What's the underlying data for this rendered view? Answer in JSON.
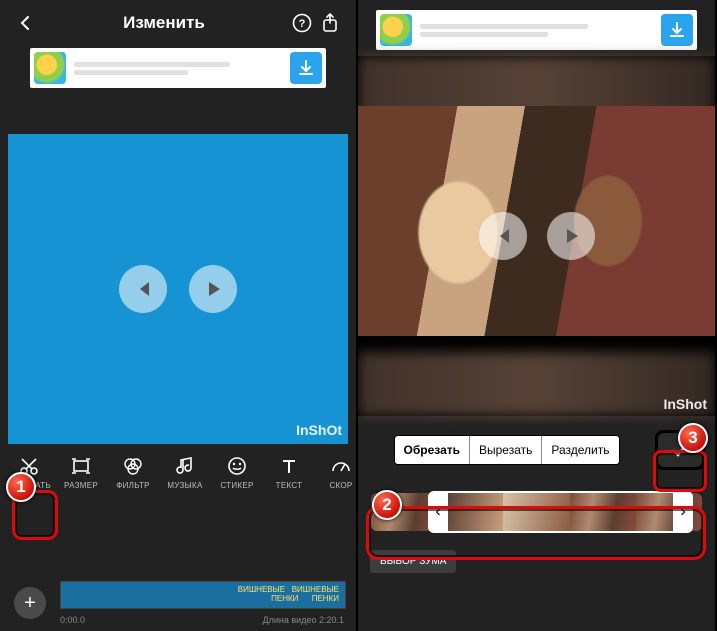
{
  "left": {
    "header_title": "Изменить",
    "ad_download_label": "download",
    "watermark": "InShOt",
    "tools": [
      {
        "icon": "scissors",
        "label": "ОБРЕЗАТЬ"
      },
      {
        "icon": "canvas",
        "label": "РАЗМЕР"
      },
      {
        "icon": "filter",
        "label": "ФИЛЬТР"
      },
      {
        "icon": "music",
        "label": "МУЗЫКА"
      },
      {
        "icon": "sticker",
        "label": "СТИКЕР"
      },
      {
        "icon": "text",
        "label": "ТЕКСТ"
      },
      {
        "icon": "speed",
        "label": "СКОР"
      }
    ],
    "timeline": {
      "start": "0:00.0",
      "length_label": "Длина видео 2:20.1"
    }
  },
  "right": {
    "watermark": "InShot",
    "segmented": [
      "Обрезать",
      "Вырезать",
      "Разделить"
    ],
    "segmented_active": 0,
    "zoom_label": "ВЫБОР ЗУМА"
  },
  "callouts": {
    "one": "1",
    "two": "2",
    "three": "3"
  }
}
